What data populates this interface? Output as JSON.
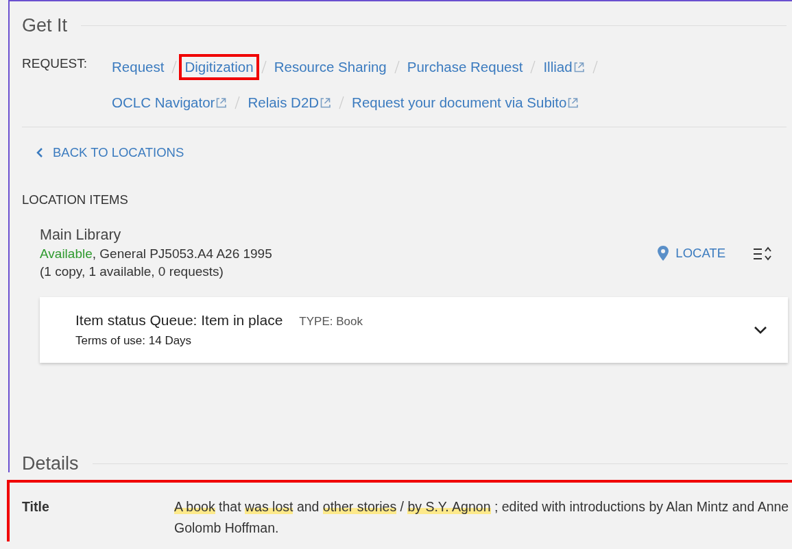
{
  "get_it": {
    "title": "Get It",
    "request": {
      "label": "REQUEST:",
      "links": [
        {
          "text": "Request",
          "external": false,
          "highlighted": false
        },
        {
          "text": "Digitization",
          "external": false,
          "highlighted": true
        },
        {
          "text": "Resource Sharing",
          "external": false,
          "highlighted": false
        },
        {
          "text": "Purchase Request",
          "external": false,
          "highlighted": false
        },
        {
          "text": "Illiad",
          "external": true,
          "highlighted": false
        },
        {
          "text": "OCLC Navigator",
          "external": true,
          "highlighted": false
        },
        {
          "text": "Relais D2D",
          "external": true,
          "highlighted": false
        },
        {
          "text": "Request your document via Subito",
          "external": true,
          "highlighted": false
        }
      ]
    },
    "back_link": "BACK TO LOCATIONS",
    "location_items_heading": "LOCATION ITEMS",
    "location": {
      "name": "Main Library",
      "status": "Available",
      "call_number": ", General PJ5053.A4 A26 1995",
      "summary": "(1 copy, 1 available, 0 requests)",
      "locate_button": "LOCATE"
    },
    "items": [
      {
        "status": "Item status Queue: Item in place",
        "type": "TYPE: Book",
        "terms": "Terms of use: 14 Days",
        "expanded": false
      }
    ]
  },
  "details": {
    "title": "Details",
    "highlighted": true,
    "rows": [
      {
        "label": "Title",
        "segments": [
          {
            "text": "A book",
            "highlighted": true
          },
          {
            "text": " that ",
            "highlighted": false
          },
          {
            "text": "was lost",
            "highlighted": true
          },
          {
            "text": " and ",
            "highlighted": false
          },
          {
            "text": "other stories",
            "highlighted": true
          },
          {
            "text": " / ",
            "highlighted": false
          },
          {
            "text": "by S.Y. Agnon",
            "highlighted": true
          },
          {
            "text": " ; edited with introductions by Alan Mintz and Anne Golomb Hoffman.",
            "highlighted": false
          }
        ]
      }
    ]
  }
}
